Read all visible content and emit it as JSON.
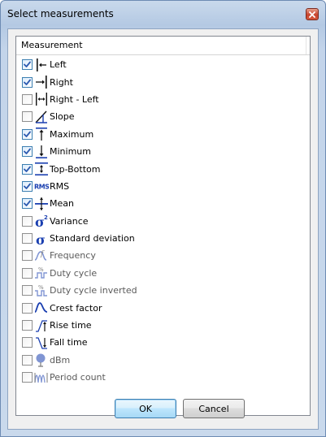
{
  "window": {
    "title": "Select measurements"
  },
  "list": {
    "header": "Measurement",
    "items": [
      {
        "label": "Left",
        "checked": true,
        "icon": "arrow-left-to-bar-icon",
        "faded": false
      },
      {
        "label": "Right",
        "checked": true,
        "icon": "arrow-right-to-bar-icon",
        "faded": false
      },
      {
        "label": "Right - Left",
        "checked": false,
        "icon": "double-arrow-between-bars-icon",
        "faded": false
      },
      {
        "label": "Slope",
        "checked": false,
        "icon": "slope-icon",
        "faded": false
      },
      {
        "label": "Maximum",
        "checked": true,
        "icon": "arrow-up-to-bar-icon",
        "faded": false
      },
      {
        "label": "Minimum",
        "checked": true,
        "icon": "arrow-down-to-bar-icon",
        "faded": false
      },
      {
        "label": "Top-Bottom",
        "checked": true,
        "icon": "top-bottom-icon",
        "faded": false
      },
      {
        "label": "RMS",
        "checked": true,
        "icon": "rms-icon",
        "faded": false
      },
      {
        "label": "Mean",
        "checked": true,
        "icon": "mean-icon",
        "faded": false
      },
      {
        "label": "Variance",
        "checked": false,
        "icon": "sigma-squared-icon",
        "faded": false
      },
      {
        "label": "Standard deviation",
        "checked": false,
        "icon": "sigma-icon",
        "faded": false
      },
      {
        "label": "Frequency",
        "checked": false,
        "icon": "frequency-icon",
        "faded": true
      },
      {
        "label": "Duty cycle",
        "checked": false,
        "icon": "duty-cycle-icon",
        "faded": true
      },
      {
        "label": "Duty cycle inverted",
        "checked": false,
        "icon": "duty-cycle-inverted-icon",
        "faded": true
      },
      {
        "label": "Crest factor",
        "checked": false,
        "icon": "crest-factor-icon",
        "faded": false
      },
      {
        "label": "Rise time",
        "checked": false,
        "icon": "rise-time-icon",
        "faded": false
      },
      {
        "label": "Fall time",
        "checked": false,
        "icon": "fall-time-icon",
        "faded": false
      },
      {
        "label": "dBm",
        "checked": false,
        "icon": "dbm-icon",
        "faded": true
      },
      {
        "label": "Period count",
        "checked": false,
        "icon": "period-count-icon",
        "faded": true
      }
    ]
  },
  "buttons": {
    "ok": "OK",
    "cancel": "Cancel"
  },
  "colors": {
    "accent": "#1a3fb0",
    "checkmark": "#2c5ab0",
    "titlebar": "#c0d3ea"
  }
}
